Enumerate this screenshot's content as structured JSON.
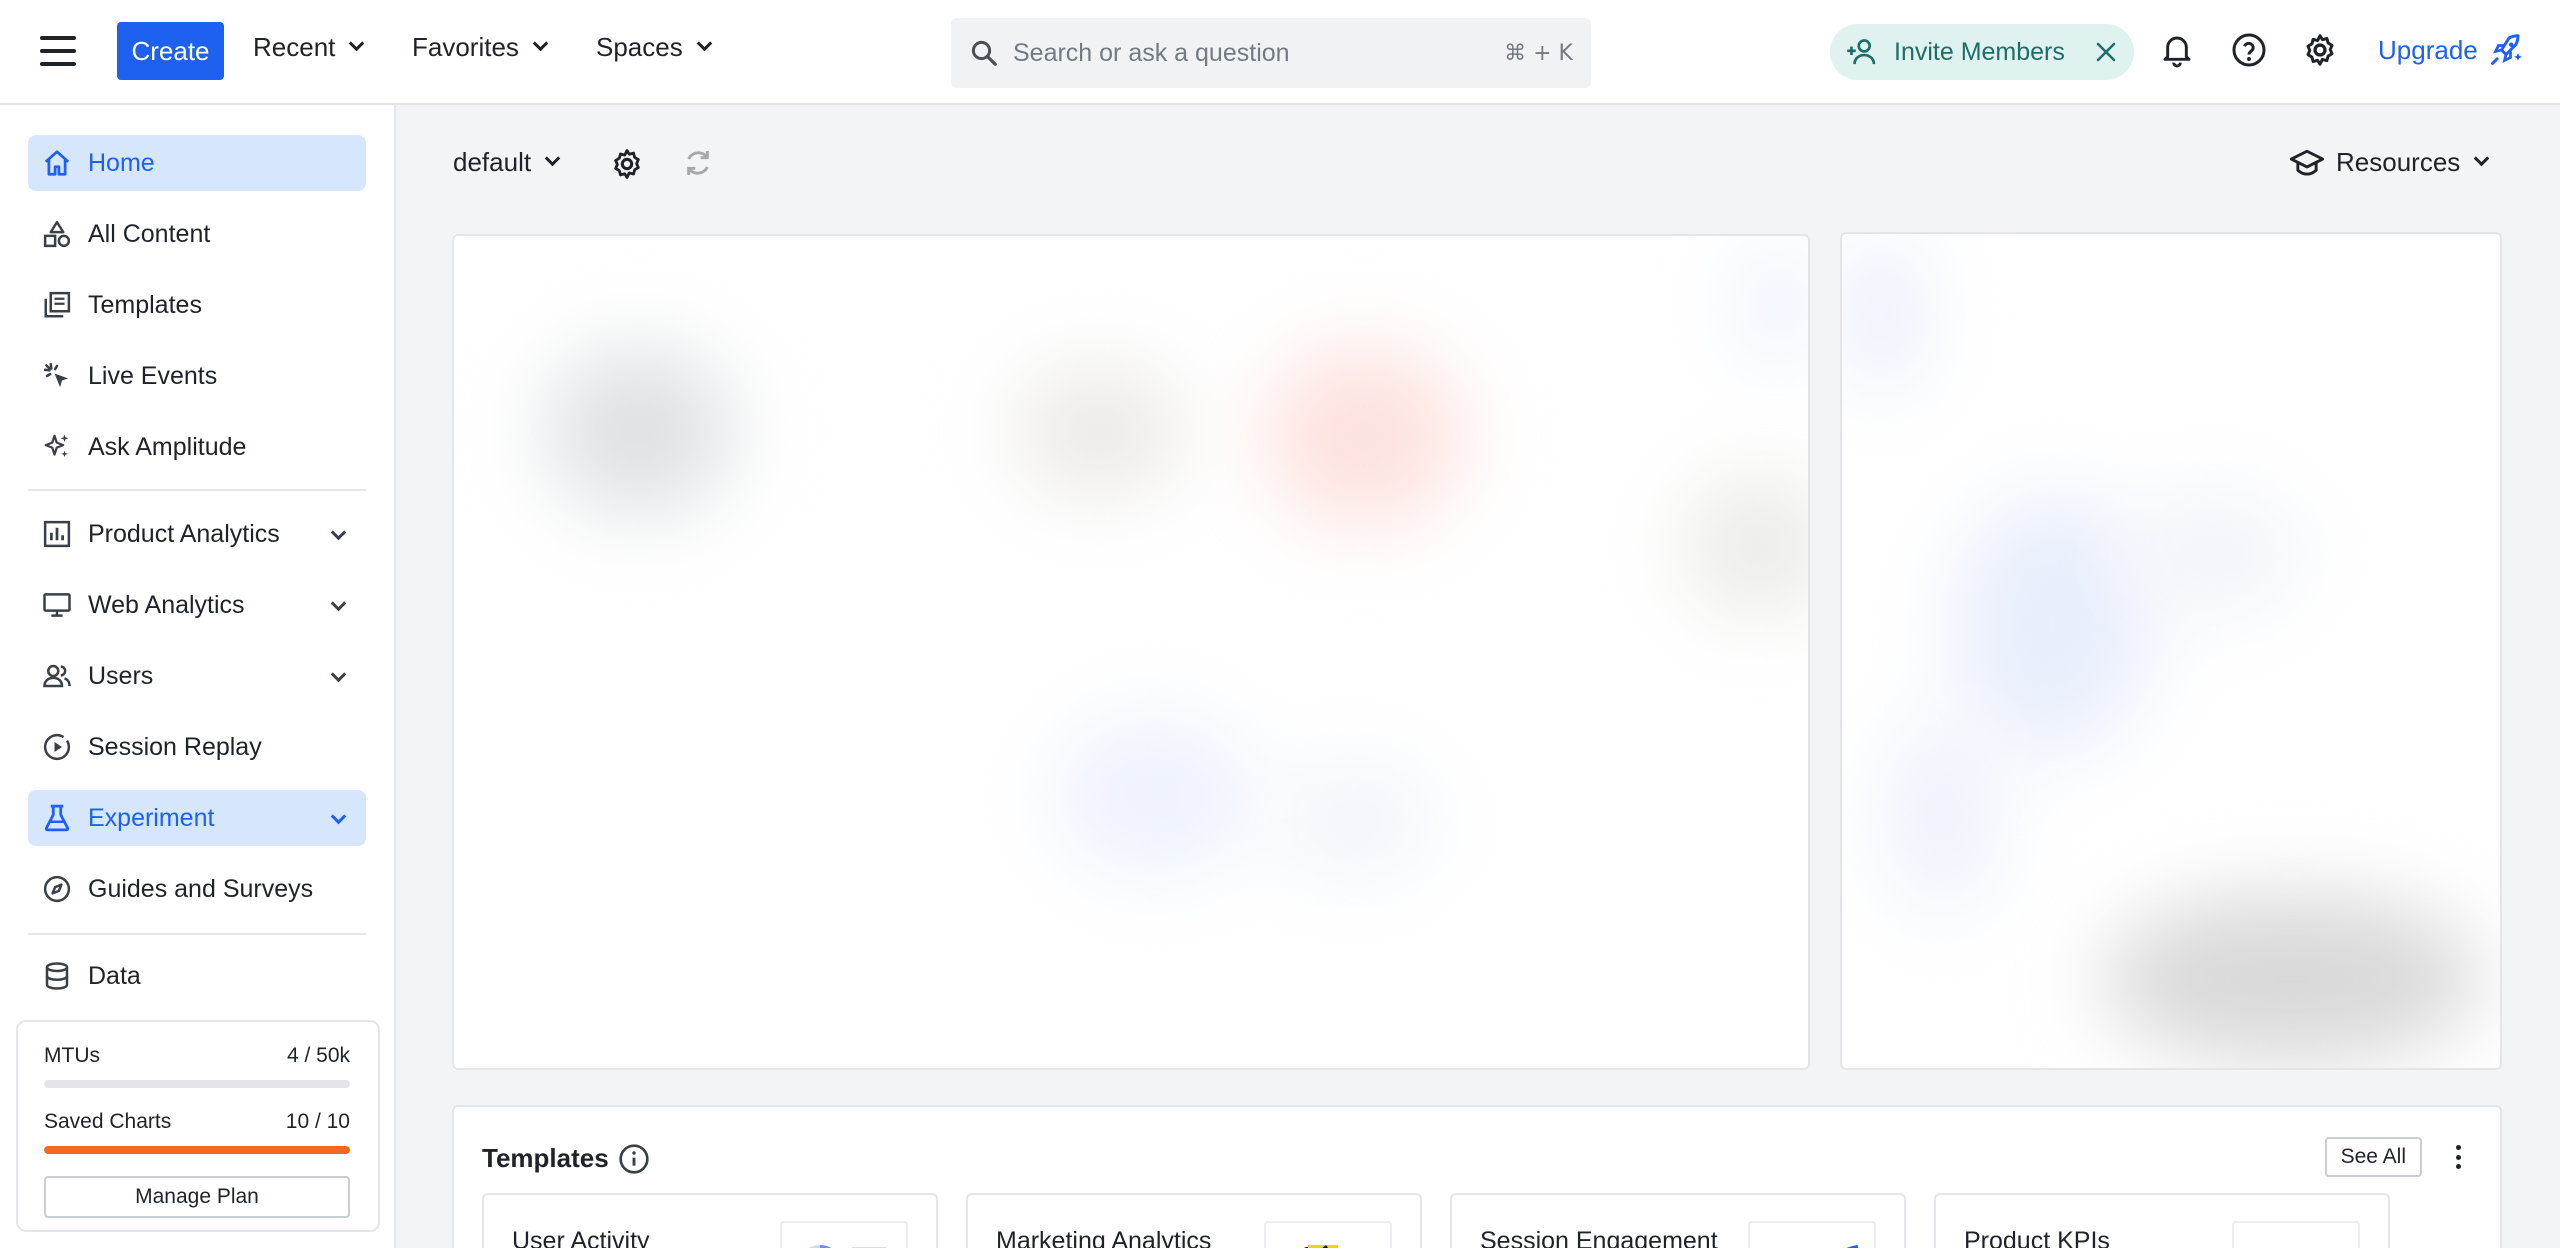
{
  "topbar": {
    "create_label": "Create",
    "menus": [
      {
        "label": "Recent"
      },
      {
        "label": "Favorites"
      },
      {
        "label": "Spaces"
      }
    ],
    "search_placeholder": "Search or ask a question",
    "search_shortcut": "⌘ + K",
    "invite_label": "Invite Members",
    "upgrade_label": "Upgrade",
    "icons": [
      "menu-icon",
      "search-icon",
      "user-plus-icon",
      "close-icon",
      "bell-icon",
      "help-icon",
      "gear-icon",
      "rocket-icon"
    ]
  },
  "sidebar": {
    "items": [
      {
        "label": "Home",
        "icon": "home-icon",
        "active": true
      },
      {
        "label": "All Content",
        "icon": "shapes-icon"
      },
      {
        "label": "Templates",
        "icon": "templates-icon"
      },
      {
        "label": "Live Events",
        "icon": "cursor-click-icon"
      },
      {
        "label": "Ask Amplitude",
        "icon": "sparkle-icon"
      },
      {
        "label": "Product Analytics",
        "icon": "bar-chart-icon",
        "expandable": true
      },
      {
        "label": "Web Analytics",
        "icon": "monitor-icon",
        "expandable": true
      },
      {
        "label": "Users",
        "icon": "users-icon",
        "expandable": true
      },
      {
        "label": "Session Replay",
        "icon": "play-circle-icon"
      },
      {
        "label": "Experiment",
        "icon": "flask-icon",
        "expandable": true,
        "active": true
      },
      {
        "label": "Guides and Surveys",
        "icon": "compass-icon"
      },
      {
        "label": "Data",
        "icon": "database-icon"
      }
    ],
    "plan": {
      "mtus_label": "MTUs",
      "mtus_value": "4 / 50k",
      "mtus_fraction": 0.0001,
      "saved_label": "Saved Charts",
      "saved_value": "10 / 10",
      "saved_fraction": 1.0,
      "manage_label": "Manage Plan",
      "saved_color": "#f26a21"
    }
  },
  "main": {
    "space_selector": "default",
    "resources_label": "Resources",
    "templates": {
      "title": "Templates",
      "see_all": "See All",
      "cards": [
        {
          "name": "User Activity"
        },
        {
          "name": "Marketing Analytics"
        },
        {
          "name": "Session Engagement"
        },
        {
          "name": "Product KPIs"
        }
      ]
    }
  },
  "colors": {
    "accent": "#1e61f0",
    "active_bg": "#d6e6fc",
    "invite_bg": "#e0f2f0",
    "invite_fg": "#1c6f68"
  }
}
